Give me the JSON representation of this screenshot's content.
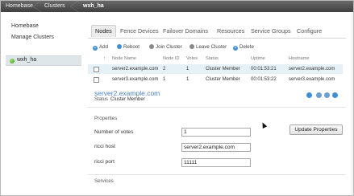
{
  "breadcrumb": {
    "items": [
      "Homebase",
      "Clusters",
      "wxh_ha"
    ]
  },
  "sidebar": {
    "links": [
      "Homebase",
      "Manage Clusters"
    ],
    "cluster": {
      "name": "wxh_ha",
      "status_color": "#4caf1f"
    }
  },
  "tabs": [
    {
      "label": "Nodes",
      "active": true
    },
    {
      "label": "Fence Devices",
      "active": false
    },
    {
      "label": "Failover Domains",
      "active": false
    },
    {
      "label": "Resources",
      "active": false
    },
    {
      "label": "Service Groups",
      "active": false
    },
    {
      "label": "Configure",
      "active": false
    }
  ],
  "toolbar": {
    "add": "Add",
    "reboot": "Reboot",
    "join": "Join Cluster",
    "leave": "Leave Cluster",
    "delete": "Delete"
  },
  "nodes_table": {
    "sort_marker": "↑",
    "headers": {
      "node_name": "Node Name",
      "node_id": "Node ID",
      "votes": "Votes",
      "status": "Status",
      "uptime": "Uptime",
      "hostname": "Hostname"
    },
    "rows": [
      {
        "node_name": "server2.example.com",
        "node_id": "2",
        "votes": "1",
        "status": "Cluster Member",
        "uptime": "00:01:53:21",
        "hostname": "server2.example.com",
        "selected": true
      },
      {
        "node_name": "server3.example.com",
        "node_id": "1",
        "votes": "1",
        "status": "Cluster Member",
        "uptime": "00:01:53:22",
        "hostname": "server3.example.com",
        "selected": false
      }
    ]
  },
  "detail": {
    "title": "server2.example.com",
    "status_label": "Status",
    "status_value": "Cluster Member",
    "properties_heading": "Properties",
    "fields": {
      "votes_label": "Number of votes",
      "votes_value": "1",
      "ricci_host_label": "ricci host",
      "ricci_host_value": "server2.example.com",
      "ricci_port_label": "ricci port",
      "ricci_port_value": "11111"
    },
    "update_button": "Update Properties",
    "services_heading": "Services"
  },
  "colors": {
    "accent": "#4a7fc0",
    "selected_row": "#e6f1f7",
    "topbar": "#4f4f4f"
  }
}
